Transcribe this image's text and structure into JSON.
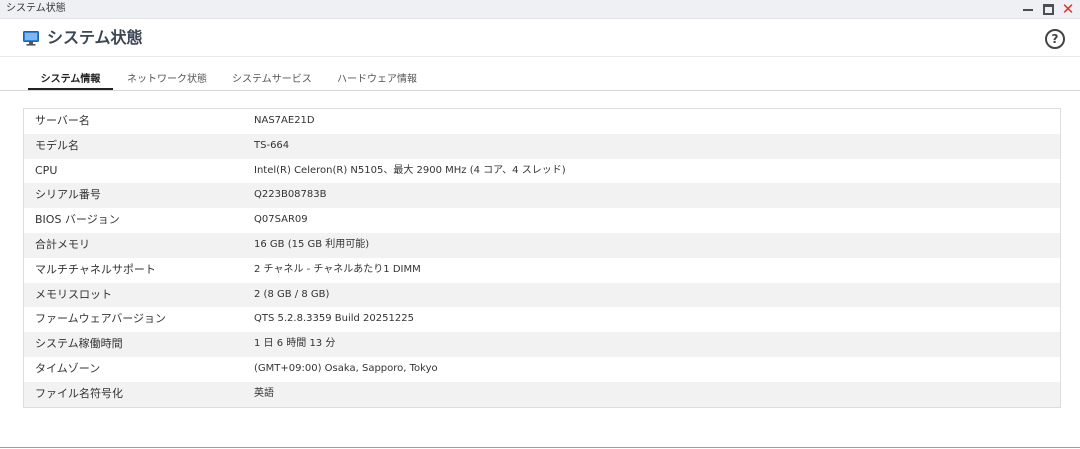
{
  "window": {
    "title": "システム状態",
    "close_glyph": "✕"
  },
  "header": {
    "title": "システム状態",
    "help_glyph": "?"
  },
  "tabs": [
    {
      "label": "システム情報",
      "active": true
    },
    {
      "label": "ネットワーク状態",
      "active": false
    },
    {
      "label": "システムサービス",
      "active": false
    },
    {
      "label": "ハードウェア情報",
      "active": false
    }
  ],
  "system_info": {
    "rows": [
      {
        "label": "サーバー名",
        "value": "NAS7AE21D"
      },
      {
        "label": "モデル名",
        "value": "TS-664"
      },
      {
        "label": "CPU",
        "value": "Intel(R) Celeron(R) N5105、最大 2900 MHz (4 コア、4 スレッド)"
      },
      {
        "label": "シリアル番号",
        "value": "Q223B08783B"
      },
      {
        "label": "BIOS バージョン",
        "value": "Q07SAR09"
      },
      {
        "label": "合計メモリ",
        "value": "16 GB (15 GB 利用可能)"
      },
      {
        "label": "マルチチャネルサポート",
        "value": "2 チャネル - チャネルあたり1 DIMM"
      },
      {
        "label": "メモリスロット",
        "value": "2 (8 GB / 8 GB)"
      },
      {
        "label": "ファームウェアバージョン",
        "value": "QTS 5.2.8.3359 Build 20251225"
      },
      {
        "label": "システム稼働時間",
        "value": "1 日 6 時間 13 分"
      },
      {
        "label": "タイムゾーン",
        "value": "(GMT+09:00) Osaka, Sapporo, Tokyo"
      },
      {
        "label": "ファイル名符号化",
        "value": "英語"
      }
    ]
  },
  "colors": {
    "accent_icon": "#2f7fd6",
    "close": "#e0302a",
    "row_alt": "#f2f2f2"
  }
}
